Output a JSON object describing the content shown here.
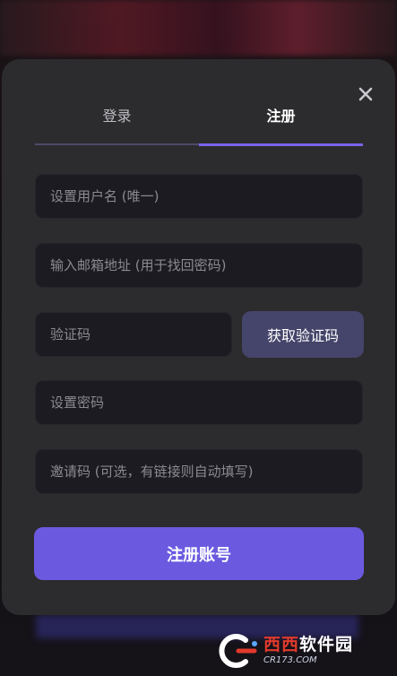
{
  "tabs": [
    {
      "label": "登录",
      "active": false
    },
    {
      "label": "注册",
      "active": true
    }
  ],
  "form": {
    "username_placeholder": "设置用户名 (唯一)",
    "email_placeholder": "输入邮箱地址 (用于找回密码)",
    "code_placeholder": "验证码",
    "get_code_label": "获取验证码",
    "password_placeholder": "设置密码",
    "invite_placeholder": "邀请码 (可选，有链接则自动填写)",
    "submit_label": "注册账号"
  },
  "icons": {
    "close": "close-icon"
  },
  "watermark": {
    "title_part1": "西西",
    "title_part2": "软件园",
    "subtitle": "CR173.COM"
  },
  "colors": {
    "accent": "#6b5ae0",
    "modal_bg": "#2c2c2e",
    "field_bg": "#1c1b21",
    "get_code_bg": "#45446a"
  }
}
